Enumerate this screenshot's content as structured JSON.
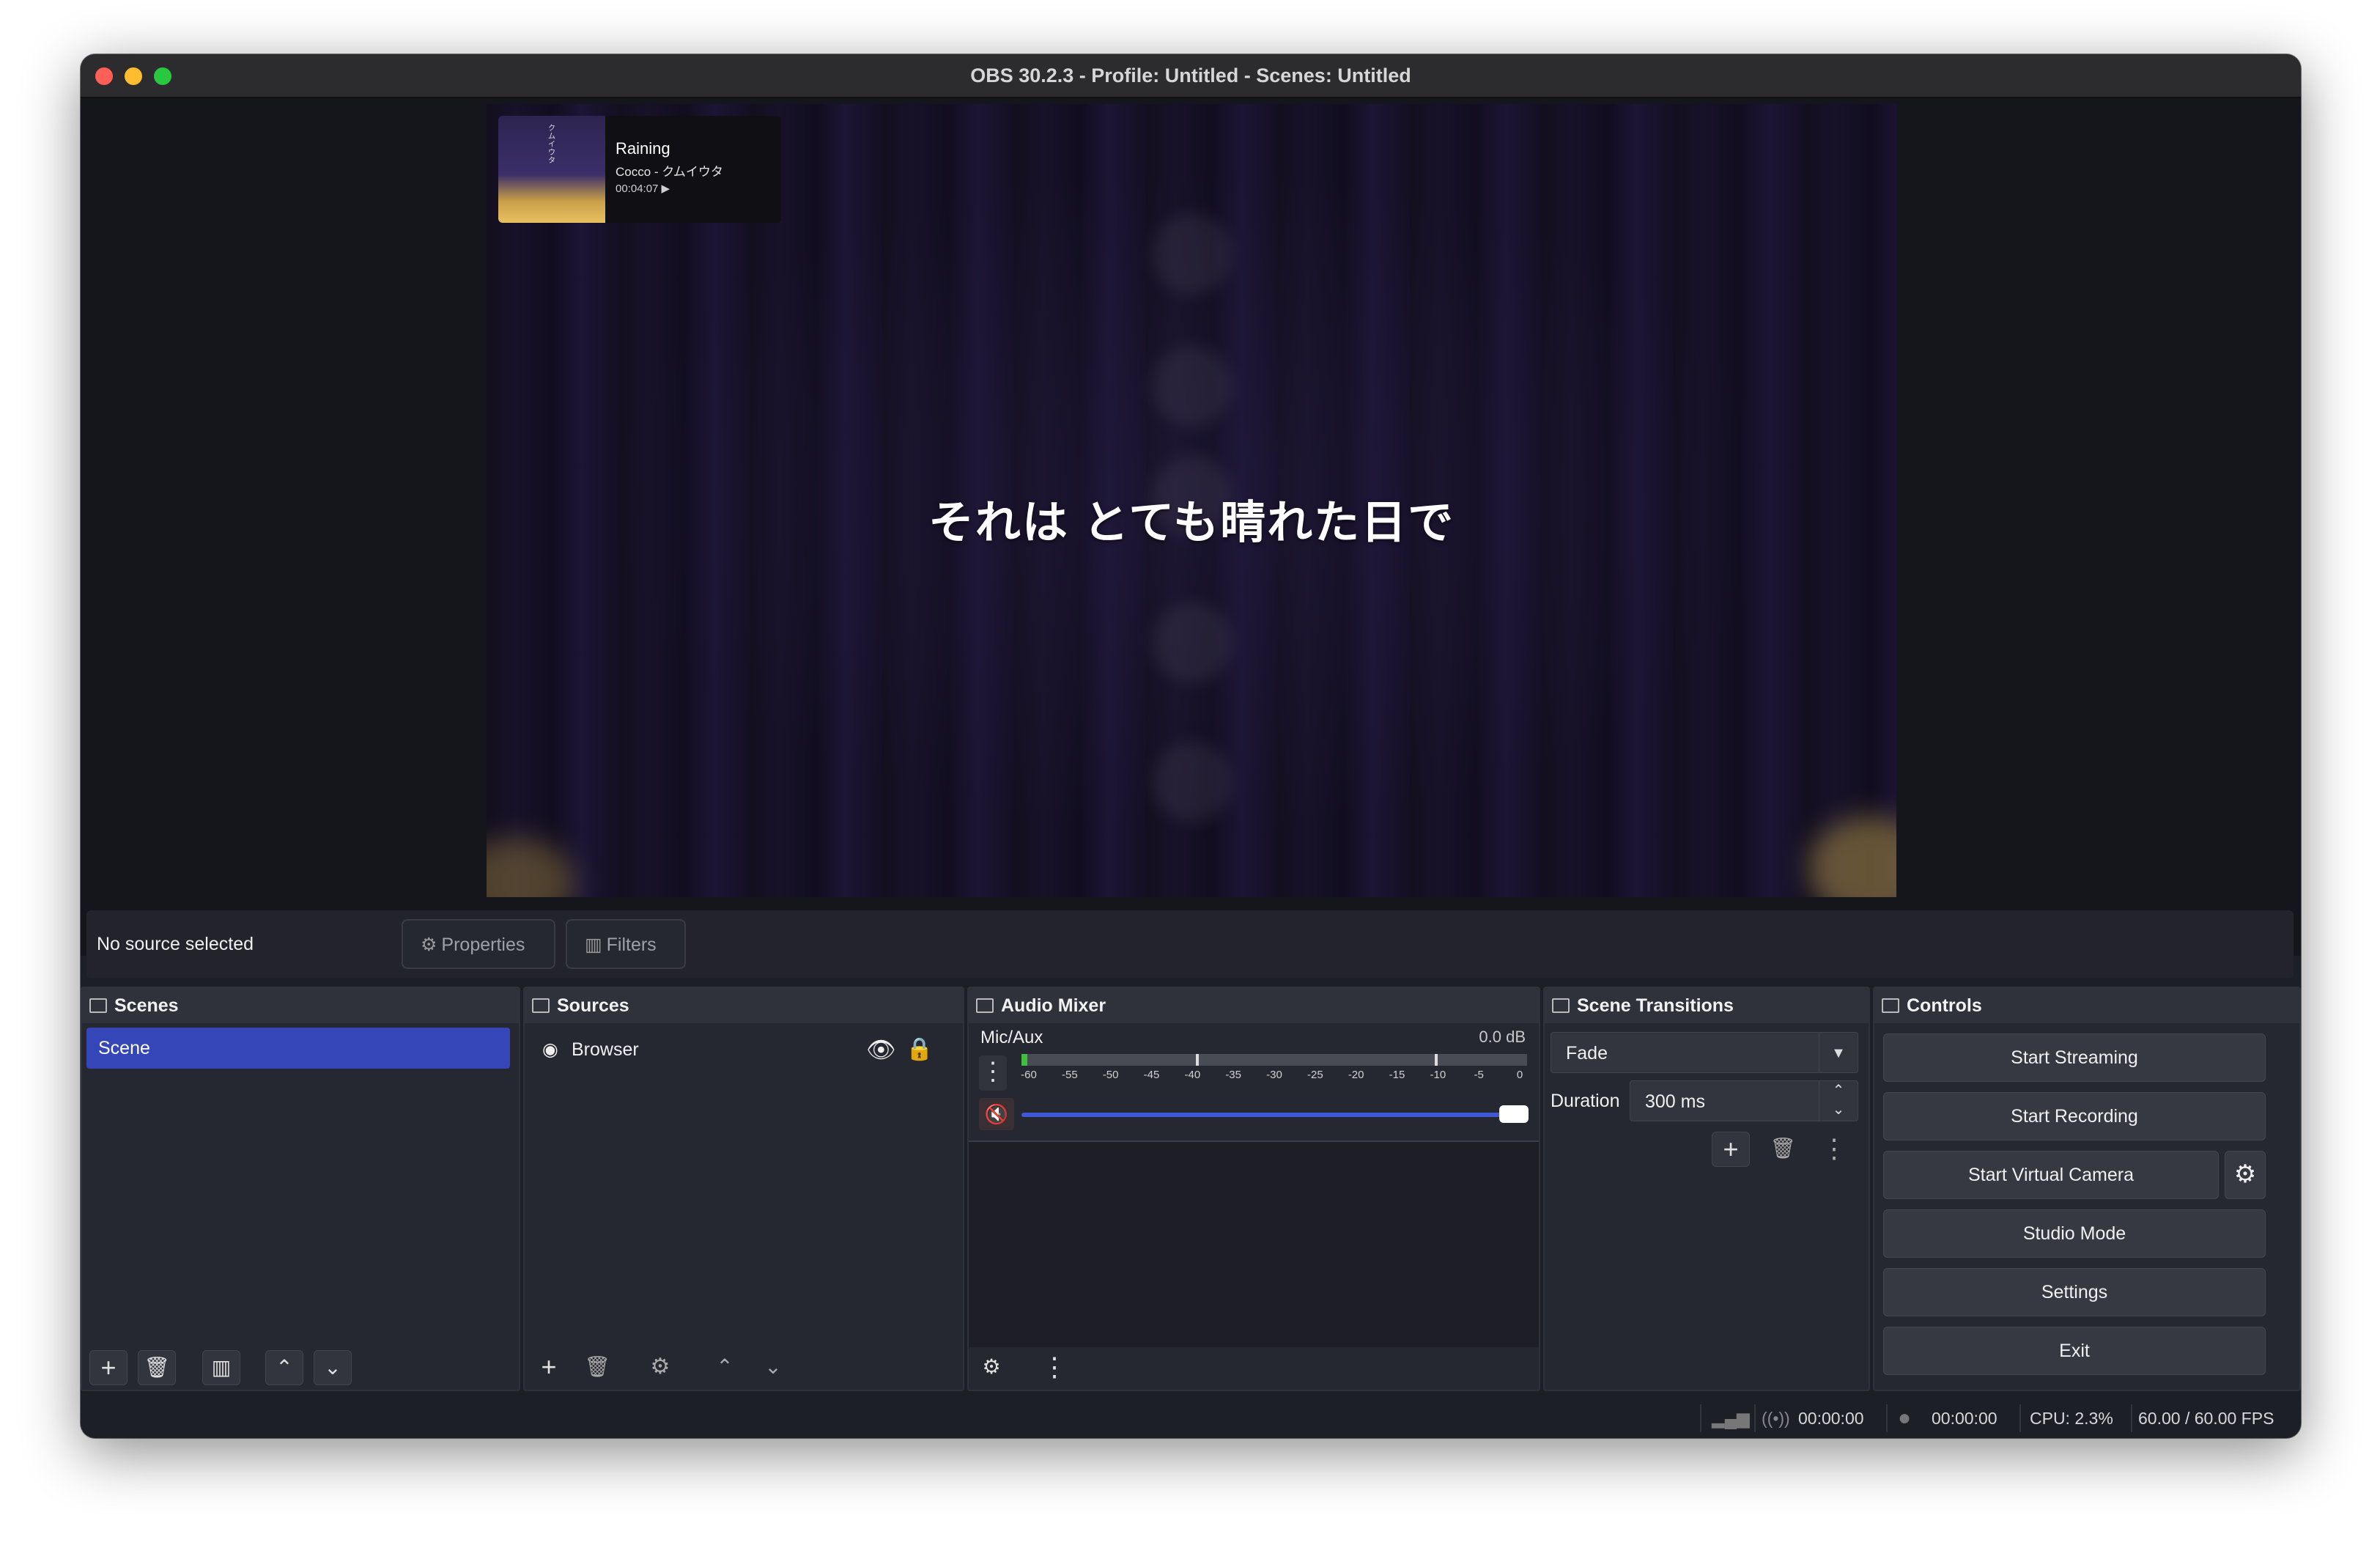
{
  "window": {
    "title": "OBS 30.2.3 - Profile: Untitled - Scenes: Untitled"
  },
  "preview": {
    "now_playing": {
      "title": "Raining",
      "artist": "Cocco - クムイウタ",
      "time": "00:04:07 ▶",
      "art_text": "クムイウタ"
    },
    "subtitle": "それは とても晴れた日で"
  },
  "source_bar": {
    "status": "No source selected",
    "properties_label": "Properties",
    "filters_label": "Filters"
  },
  "scenes": {
    "header": "Scenes",
    "items": [
      "Scene"
    ]
  },
  "sources": {
    "header": "Sources",
    "items": [
      {
        "label": "Browser"
      }
    ]
  },
  "audio_mixer": {
    "header": "Audio Mixer",
    "channel": "Mic/Aux",
    "level": "0.0 dB",
    "scale": [
      "-60",
      "-55",
      "-50",
      "-45",
      "-40",
      "-35",
      "-30",
      "-25",
      "-20",
      "-15",
      "-10",
      "-5",
      "0"
    ],
    "volume_fraction": 1.0
  },
  "scene_transitions": {
    "header": "Scene Transitions",
    "transition": "Fade",
    "duration_label": "Duration",
    "duration_value": "300 ms"
  },
  "controls": {
    "header": "Controls",
    "start_streaming": "Start Streaming",
    "start_recording": "Start Recording",
    "start_virtual_camera": "Start Virtual Camera",
    "studio_mode": "Studio Mode",
    "settings": "Settings",
    "exit": "Exit"
  },
  "status_bar": {
    "stream_time": "00:00:00",
    "record_time": "00:00:00",
    "cpu": "CPU: 2.3%",
    "fps": "60.00 / 60.00 FPS"
  },
  "colors": {
    "accent": "#3546b8",
    "fader": "#3f58d6",
    "background": "#1d1f26"
  }
}
